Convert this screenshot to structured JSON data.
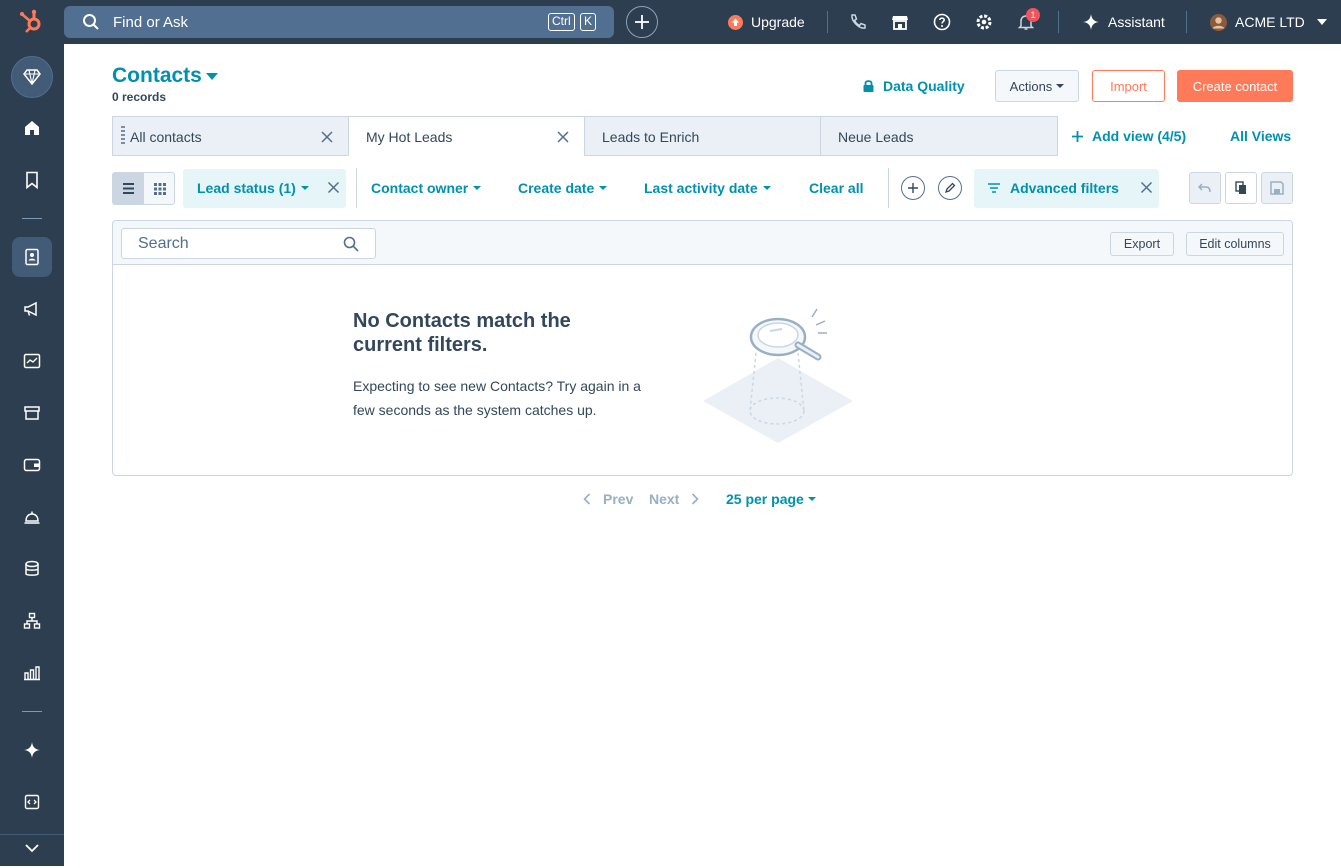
{
  "topbar": {
    "search_label": "Find or Ask",
    "kbd_ctrl": "Ctrl",
    "kbd_k": "K",
    "upgrade": "Upgrade",
    "notification_count": "1",
    "assistant": "Assistant",
    "account": "ACME LTD"
  },
  "page": {
    "title": "Contacts",
    "records": "0 records",
    "data_quality": "Data Quality",
    "actions": "Actions",
    "import": "Import",
    "create": "Create contact"
  },
  "tabs": [
    {
      "label": "All contacts"
    },
    {
      "label": "My Hot Leads"
    },
    {
      "label": "Leads to Enrich"
    },
    {
      "label": "Neue Leads"
    }
  ],
  "views": {
    "add_view": "Add view (4/5)",
    "all_views": "All Views"
  },
  "filters": {
    "lead_status": "Lead status (1)",
    "contact_owner": "Contact owner",
    "create_date": "Create date",
    "last_activity": "Last activity date",
    "clear_all": "Clear all",
    "advanced": "Advanced filters"
  },
  "table": {
    "search_placeholder": "Search",
    "export": "Export",
    "edit_columns": "Edit columns",
    "empty_title": "No Contacts match the current filters.",
    "empty_text": "Expecting to see new Contacts? Try again in a few seconds as the system catches up."
  },
  "pager": {
    "prev": "Prev",
    "next": "Next",
    "per_page": "25 per page"
  },
  "colors": {
    "nav_bg": "#2d3e50",
    "accent": "#0091ae",
    "brand_orange": "#ff7a59"
  }
}
